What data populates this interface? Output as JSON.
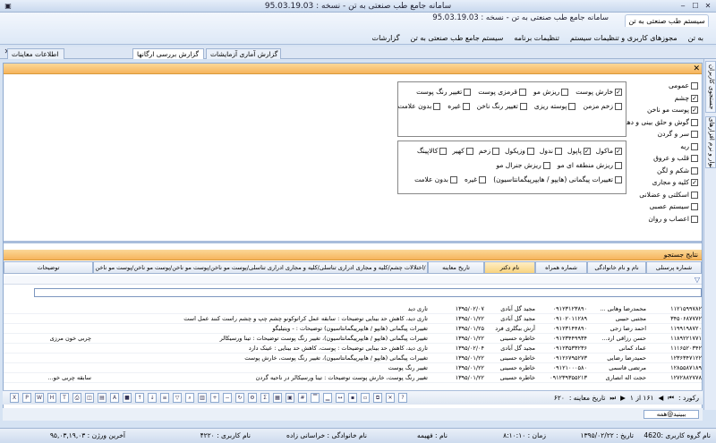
{
  "window": {
    "title": "سامانه جامع طب صنعتی به تن  -  نسخه : 95.03.19.03"
  },
  "ribbon": {
    "app_tab": "سیستم طب صنعتی به تن",
    "title": "سامانه جامع طب صنعتی به تن  -  نسخه : 95.03.19.03",
    "menu": [
      "به تن",
      "مجوزهای کاربری و تنظیمات سیستم",
      "تنظیمات برنامه",
      "سیستم جامع طب صنعتی به تن",
      "گزارشات"
    ]
  },
  "doc_tabs": [
    "گزارش بررسی ارگانها",
    "گزارش آماری آزمایشات",
    "اطلاعات معاینات"
  ],
  "sidebar_tabs": [
    "جستجوی کاربران",
    "نوار و نرم افزارهای"
  ],
  "categories": [
    {
      "label": "عمومی",
      "checked": false
    },
    {
      "label": "چشم",
      "checked": true
    },
    {
      "label": "پوست مو ناخن",
      "checked": true
    },
    {
      "label": "گوش و حلق بینی و دهان",
      "checked": false
    },
    {
      "label": "سر و گردن",
      "checked": false
    },
    {
      "label": "ریه",
      "checked": false
    },
    {
      "label": "قلب و عروق",
      "checked": false
    },
    {
      "label": "شکم و لگن",
      "checked": false
    },
    {
      "label": "کلیه و مجاری",
      "checked": true
    },
    {
      "label": "اسکلتی و عضلانی",
      "checked": false
    },
    {
      "label": "سیستم عصبی",
      "checked": false
    },
    {
      "label": "اعصاب و روان",
      "checked": false
    }
  ],
  "skin_options": {
    "row1": [
      {
        "label": "خارش پوست",
        "checked": true
      },
      {
        "label": "ریزش مو",
        "checked": false
      },
      {
        "label": "قرمزی پوست",
        "checked": false
      },
      {
        "label": "تغییر رنگ پوست",
        "checked": false
      }
    ],
    "row2": [
      {
        "label": "زخم مزمن",
        "checked": false
      },
      {
        "label": "پوسته ریزی",
        "checked": false
      },
      {
        "label": "تغییر رنگ ناخن",
        "checked": false
      },
      {
        "label": "غیره",
        "checked": false
      },
      {
        "label": "بدون علامت",
        "checked": false
      }
    ]
  },
  "kidney_options": {
    "row1": [
      {
        "label": "ماکول",
        "checked": true
      },
      {
        "label": "پاپول",
        "checked": true
      },
      {
        "label": "ندول",
        "checked": false
      },
      {
        "label": "وزیکول",
        "checked": false
      },
      {
        "label": "زخم",
        "checked": false
      },
      {
        "label": "کهیر",
        "checked": false
      },
      {
        "label": "کالاپینگ",
        "checked": false
      }
    ],
    "row2": [
      {
        "label": "ریزش منطقه ای مو",
        "checked": false
      },
      {
        "label": "ریزش جنرال مو",
        "checked": false
      }
    ],
    "row3": [
      {
        "label": "تغییرات پیگمانی (هایپو / هایپرپیگمانتاسیون)",
        "checked": false
      },
      {
        "label": "غیره",
        "checked": false
      },
      {
        "label": "بدون علامت",
        "checked": false
      }
    ]
  },
  "results": {
    "header": "نتایج جستجو",
    "columns": [
      "شماره پرسنلی",
      "نام و نام خانوادگی",
      "شماره همراه",
      "نام دکتر",
      "تاریخ معاینه",
      "اختلالات چشم/کلیه و مجاری ادراری تناسلی/کلیه و مجاری ادراری تناسلی/پوست مو ناخن/پوست مو ناخن/پوست مو ناخن/پوست مو ناخن/",
      "توضیحات"
    ],
    "rows": [
      {
        "id": "۱۱۲۱۵۹۹۷۸۲",
        "name": "محمدرضا وهابی ...",
        "phone": "۰۹۱۲۳۱۲۳۸۹۰",
        "doctor": "مجید گل آبادی",
        "date": "۱۳۹۵/۰۲/۰۷",
        "findings": "تاری دید",
        "notes": ""
      },
      {
        "id": "۳۴۵۰۶۸۷۷۷۲",
        "name": "مجتبی حبیبی",
        "phone": "۰۹۱۰۲۰۱۱۲۸۹",
        "doctor": "مجید گل آبادی",
        "date": "۱۳۹۵/۰۱/۲۲",
        "findings": "تاری دید، کاهش حد بینایی  توضیحات : سابقه عمل کراتوکونو چشم چپ و چشم راست کنند عمل است",
        "notes": ""
      },
      {
        "id": "۱۱۹۹۱۹۸۷۲۰",
        "name": "احمد رضا زجی",
        "phone": "۰۹۱۲۳۱۴۴۸۹۰",
        "doctor": "آرش بیگلری فرد",
        "date": "۱۳۹۵/۰۱/۲۵",
        "findings": "تغییرات پیگمانی (هایپو / هایپرپیگمانتاسیون)  توضیحات : - ویتیلیگو",
        "notes": ""
      },
      {
        "id": "۱۱۸۹۲۲۱۷۷۱",
        "name": "حسن  رزاقی ارد...",
        "phone": "۰۹۱۲۳۴۴۹۹۳۴",
        "doctor": "خاطره حسینی",
        "date": "۱۳۹۵/۰۱/۲۲",
        "findings": "تغییرات پیگمانی (هایپو / هایپرپیگمانتاسیون)، تغییر رنگ پوست  توضیحات : تینا ورسیکالر",
        "notes": "چربی خون مرزی"
      },
      {
        "id": "۱۱۱۶۵۲۰۳۴۲",
        "name": "عماد کمانی",
        "phone": "۰۹۱۲۳۵۳۳۲۳۶",
        "doctor": "مجید گل آبادی",
        "date": "۱۳۹۵/۰۲/۰۴",
        "findings": "تاری دید، کاهش حد بینایی  توضیحات : پوست، کاهش حد بینایی : عینک دارد",
        "notes": ""
      },
      {
        "id": "۱۲۳۶۳۴۷۱۲۲",
        "name": "حمیدرضا رضایی",
        "phone": "۰۹۱۲۶۷۹۵۲۷۳",
        "doctor": "خاطره حسینی",
        "date": "۱۳۹۵/۰۱/۲۲",
        "findings": "تغییرات پیگمانی (هایپو / هایپرپیگمانتاسیون)، تغییر رنگ پوست، خارش پوست",
        "notes": ""
      },
      {
        "id": "۱۲۸۵۵۸۷۱۸۹",
        "name": "مرتضی قاسمی",
        "phone": "۰۹۱۲۱۰۰۰۵۸۰",
        "doctor": "خاطره حسینی",
        "date": "۱۳۹۵/۰۱/۲۲",
        "findings": "تغییر رنگ پوست",
        "notes": ""
      },
      {
        "id": "۱۲۷۲۸۸۲۷۷۸",
        "name": "حجت اله انصاری",
        "phone": "۰۹۱۲۳۹۳۵۵۲۱۳",
        "doctor": "خاطره حسینی",
        "date": "۱۳۹۵/۰۱/۲۲",
        "findings": "تغییر رنگ پوست، خارش پوست  توضیحات : تینا ورسیکالر در ناحیه گردن",
        "notes": "سابقه چربی خو..."
      }
    ]
  },
  "pager": {
    "label": "رکورد :",
    "position": "۱۶۱ از ۱",
    "date_label": "تاریخ معاینه :",
    "zoom": "۶۲۰"
  },
  "findrow": {
    "text": "ببينيد@همه"
  },
  "status": {
    "group": "نام گروه کاربری :4620",
    "date": "تاریخ : ۱۳۹۵/۰۲/۲۲",
    "time": "زمان : ۸:۱۰:۱۰",
    "name": "نام : فهیمه",
    "family": "نام خانوادگی : خراسانی زاده",
    "user": "نام کاربری : ۴۲۲۰",
    "version": "آخرین ورژن : ۹۵,۰۳,۱۹,۰۳"
  }
}
